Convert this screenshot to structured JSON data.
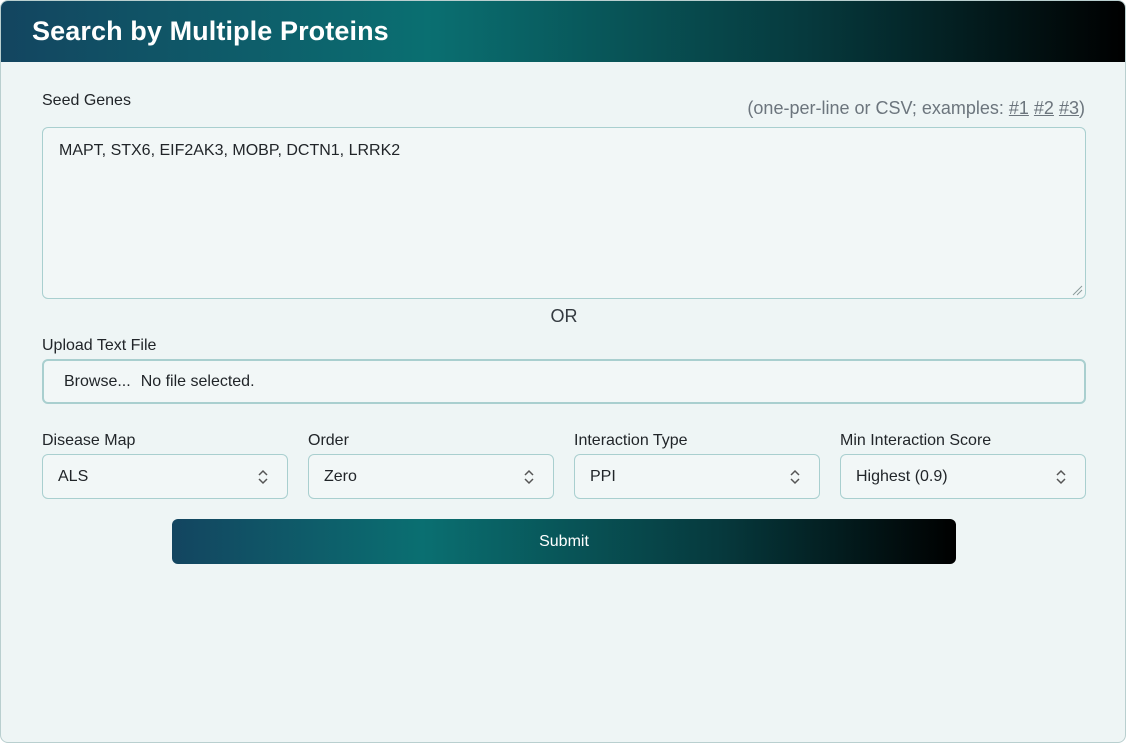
{
  "header": {
    "title": "Search by Multiple Proteins"
  },
  "seed_genes": {
    "label": "Seed Genes",
    "hint_prefix": "(one-per-line or CSV; examples: ",
    "examples": [
      "#1",
      "#2",
      "#3"
    ],
    "hint_suffix": ")",
    "value": "MAPT, STX6, EIF2AK3, MOBP, DCTN1, LRRK2"
  },
  "separator": "OR",
  "upload": {
    "label": "Upload Text File",
    "browse_label": "Browse...",
    "status": "No file selected."
  },
  "selects": [
    {
      "label": "Disease Map",
      "value": "ALS"
    },
    {
      "label": "Order",
      "value": "Zero"
    },
    {
      "label": "Interaction Type",
      "value": "PPI"
    },
    {
      "label": "Min Interaction Score",
      "value": "Highest (0.9)"
    }
  ],
  "submit_label": "Submit",
  "colors": {
    "gradient_start": "#134560",
    "gradient_mid": "#0a6f71",
    "gradient_end": "#000000",
    "panel_bg": "#eef5f5",
    "border": "#a9cfcf"
  },
  "icons": {
    "select_arrows": "chevron-up-down-icon",
    "resize": "resize-grip-icon"
  }
}
